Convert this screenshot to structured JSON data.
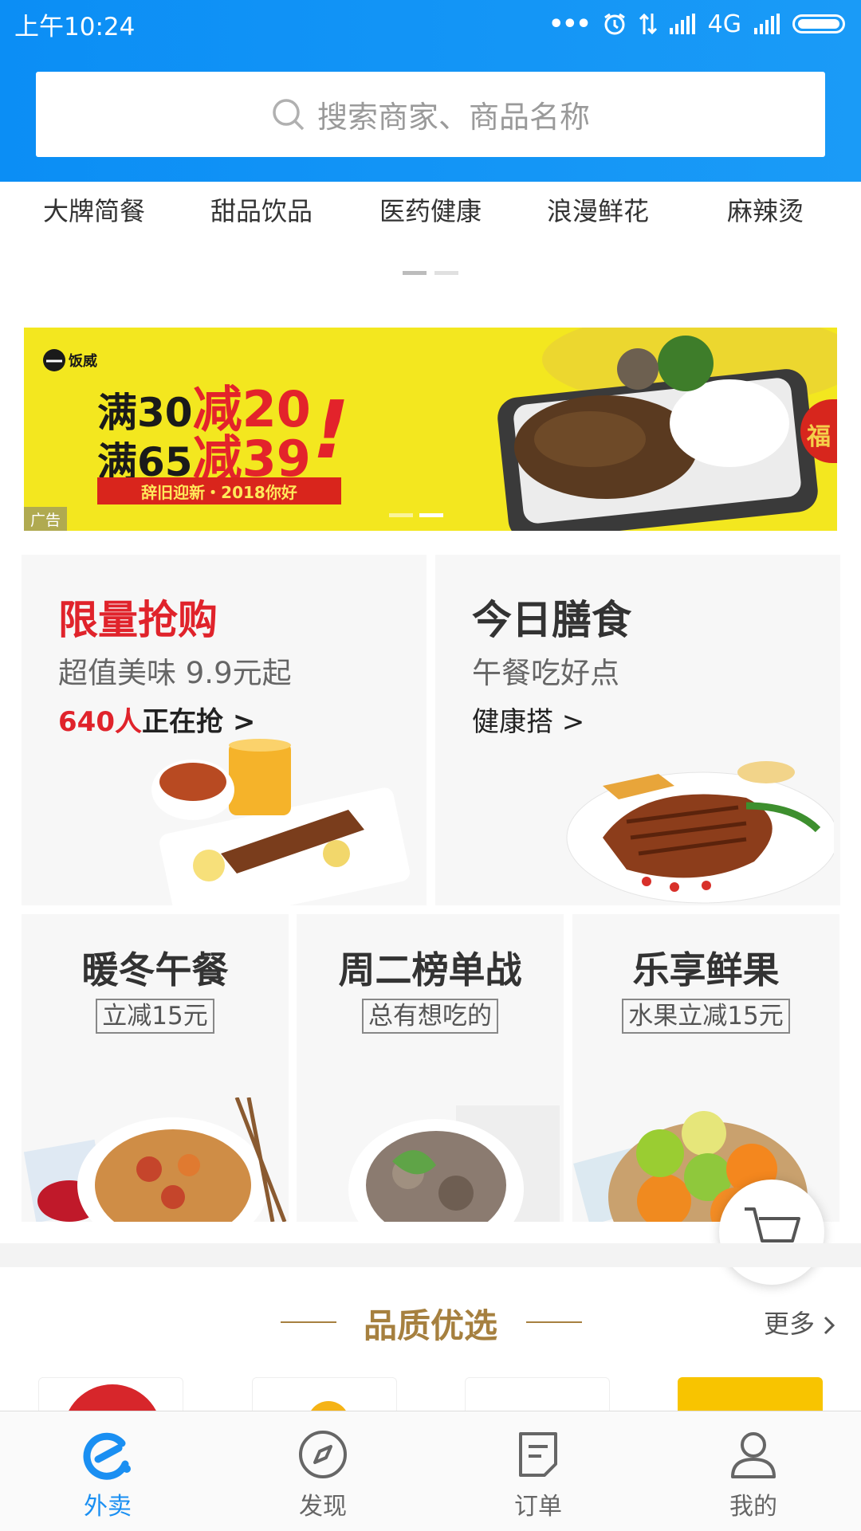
{
  "status_bar": {
    "time": "上午10:24",
    "network": "4G"
  },
  "search": {
    "placeholder": "搜索商家、商品名称"
  },
  "categories": [
    "大牌简餐",
    "甜品饮品",
    "医药健康",
    "浪漫鲜花",
    "麻辣烫"
  ],
  "banner": {
    "logo_text": "饭威",
    "line1_prefix": "满30",
    "line1_highlight": "减20",
    "line2_prefix": "满65",
    "line2_highlight": "减39",
    "exclaim": "!",
    "slogan": "辞旧迎新・2018你好",
    "ad_label": "广告",
    "side_char": "福"
  },
  "tiles": {
    "flash_sale": {
      "title": "限量抢购",
      "subtitle": "超值美味 9.9元起",
      "count": "640人",
      "action": "正在抢 >"
    },
    "today_meal": {
      "title": "今日膳食",
      "subtitle": "午餐吃好点",
      "action": "健康搭 >"
    },
    "winter_lunch": {
      "title": "暖冬午餐",
      "tag": "立减15元"
    },
    "tuesday_rank": {
      "title": "周二榜单战",
      "tag": "总有想吃的"
    },
    "fruit": {
      "title": "乐享鲜果",
      "tag": "水果立减15元"
    }
  },
  "quality_section": {
    "title": "品质优选",
    "more": "更多"
  },
  "bottom_nav": [
    {
      "label": "外卖",
      "active": true
    },
    {
      "label": "发现",
      "active": false
    },
    {
      "label": "订单",
      "active": false
    },
    {
      "label": "我的",
      "active": false
    }
  ],
  "colors": {
    "brand_blue": "#0b8ef5",
    "accent_red": "#e0232b",
    "quality_gold": "#a6803f"
  }
}
